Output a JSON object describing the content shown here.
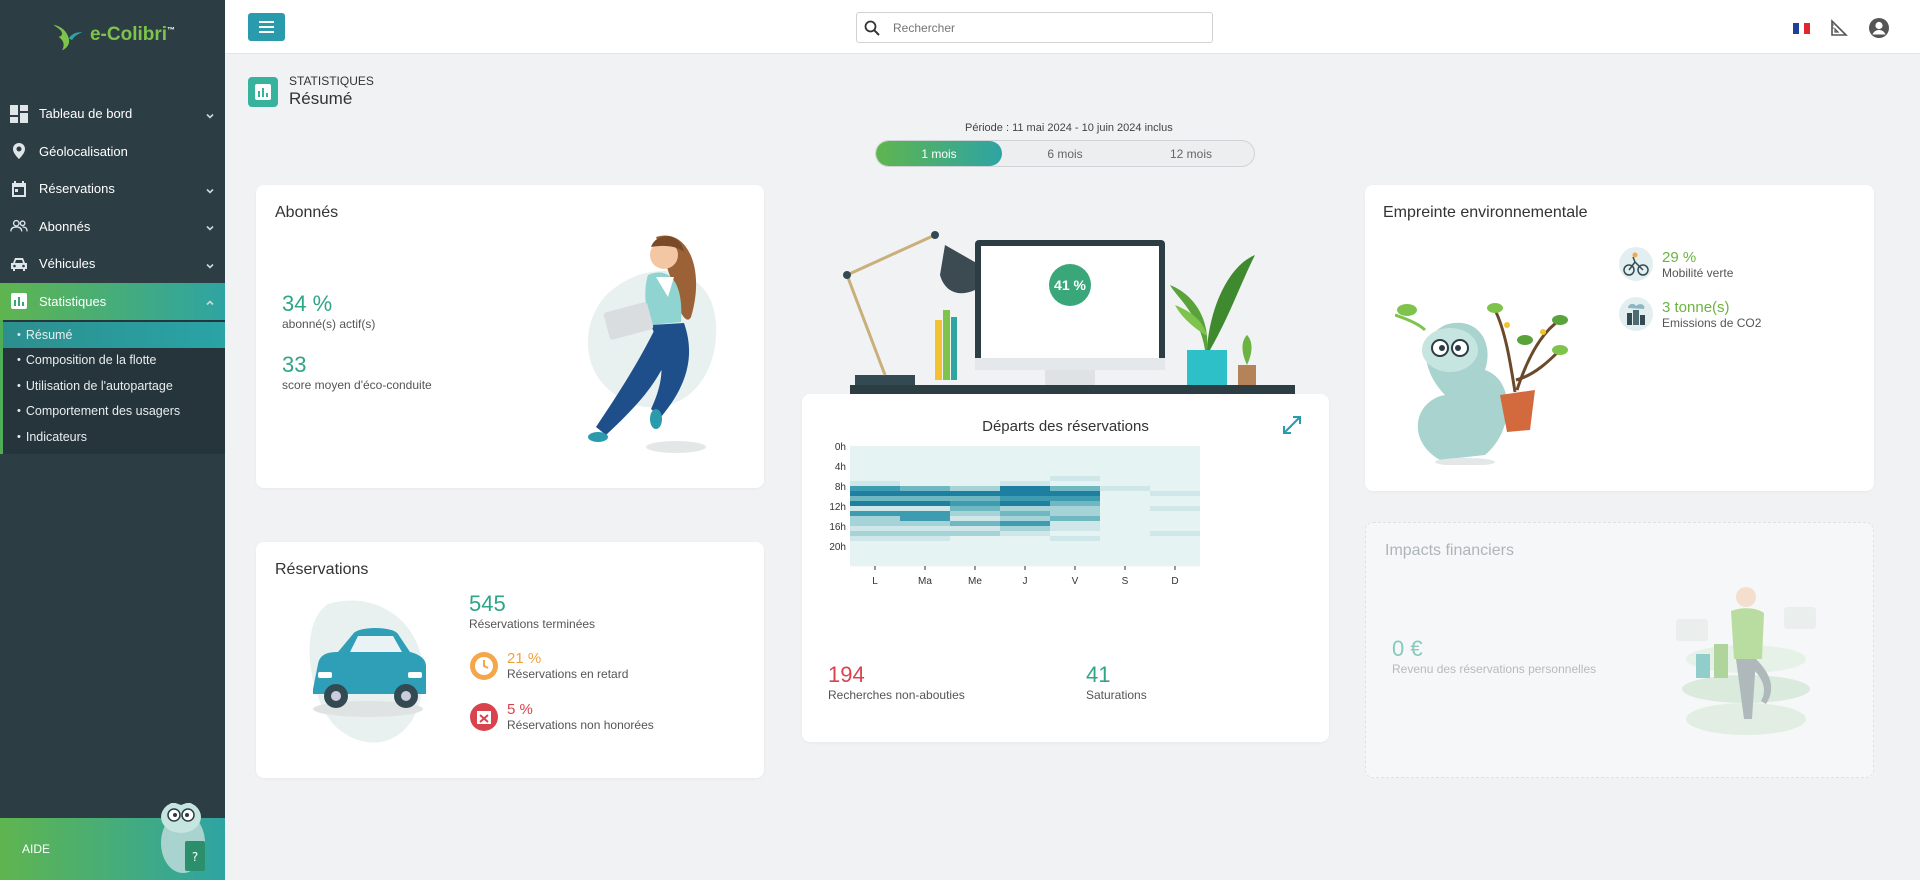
{
  "app": {
    "logo": "e-Colibri",
    "logo_mark": "™"
  },
  "sidebar": {
    "items": [
      {
        "label": "Tableau de bord",
        "icon": "dashboard-icon",
        "has_chevron": true
      },
      {
        "label": "Géolocalisation",
        "icon": "map-pin-icon",
        "has_chevron": false
      },
      {
        "label": "Réservations",
        "icon": "calendar-icon",
        "has_chevron": true
      },
      {
        "label": "Abonnés",
        "icon": "users-icon",
        "has_chevron": true
      },
      {
        "label": "Véhicules",
        "icon": "car-icon",
        "has_chevron": true
      },
      {
        "label": "Statistiques",
        "icon": "bar-chart-icon",
        "has_chevron": true,
        "active": true
      }
    ],
    "subitems": [
      {
        "label": "Résumé",
        "active": true
      },
      {
        "label": "Composition de la flotte"
      },
      {
        "label": "Utilisation de l'autopartage"
      },
      {
        "label": "Comportement des usagers"
      },
      {
        "label": "Indicateurs"
      }
    ],
    "help_label": "AIDE"
  },
  "topbar": {
    "search_placeholder": "Rechercher",
    "icons": [
      "flag-fr-icon",
      "ruler-triangle-icon",
      "user-circle-icon"
    ]
  },
  "page": {
    "pretitle": "STATISTIQUES",
    "title": "Résumé"
  },
  "period": {
    "label": "Période : 11 mai 2024 - 10 juin 2024 inclus",
    "options": [
      "1 mois",
      "6 mois",
      "12 mois"
    ],
    "selected": "1 mois"
  },
  "abonnes": {
    "title": "Abonnés",
    "active_value": "34 %",
    "active_label": "abonné(s) actif(s)",
    "score_value": "33",
    "score_label": "score moyen d'éco-conduite"
  },
  "reservations": {
    "title": "Réservations",
    "done_value": "545",
    "done_label": "Réservations terminées",
    "late_value": "21 %",
    "late_label": "Réservations en retard",
    "noshow_value": "5 %",
    "noshow_label": "Réservations non honorées"
  },
  "desk": {
    "screen_value": "41 %"
  },
  "departs": {
    "title": "Départs des réservations",
    "failed_value": "194",
    "failed_label": "Recherches non-abouties",
    "saturation_value": "41",
    "saturation_label": "Saturations"
  },
  "chart_data": {
    "type": "heatmap",
    "title": "Départs des réservations",
    "x": [
      "L",
      "Ma",
      "Me",
      "J",
      "V",
      "S",
      "D"
    ],
    "y_ticks": [
      "0h",
      "4h",
      "8h",
      "12h",
      "16h",
      "20h"
    ],
    "rows_per_day": 24,
    "colors": [
      "#e6f3f3",
      "#cfe7e8",
      "#a6d3d7",
      "#6fb8c2",
      "#3d9cb0",
      "#1f7fa0"
    ],
    "intensity": [
      [
        0,
        0,
        0,
        0,
        0,
        0,
        0,
        1,
        4,
        5,
        3,
        5,
        1,
        4,
        2,
        2,
        1,
        2,
        1,
        0,
        0,
        0,
        0,
        0
      ],
      [
        0,
        0,
        0,
        0,
        0,
        0,
        0,
        0,
        3,
        5,
        3,
        5,
        1,
        4,
        4,
        2,
        1,
        2,
        1,
        0,
        0,
        0,
        0,
        0
      ],
      [
        0,
        0,
        0,
        0,
        0,
        0,
        0,
        0,
        2,
        5,
        3,
        4,
        3,
        2,
        1,
        3,
        1,
        2,
        0,
        0,
        0,
        0,
        0,
        0
      ],
      [
        0,
        0,
        0,
        0,
        0,
        0,
        0,
        1,
        5,
        5,
        4,
        5,
        2,
        3,
        2,
        4,
        2,
        1,
        0,
        0,
        0,
        0,
        0,
        0
      ],
      [
        0,
        0,
        0,
        0,
        0,
        0,
        1,
        0,
        3,
        5,
        4,
        3,
        2,
        2,
        3,
        1,
        1,
        0,
        1,
        0,
        0,
        0,
        0,
        0
      ],
      [
        0,
        0,
        0,
        0,
        0,
        0,
        0,
        0,
        1,
        0,
        0,
        0,
        0,
        0,
        0,
        0,
        0,
        0,
        0,
        0,
        0,
        0,
        0,
        0
      ],
      [
        0,
        0,
        0,
        0,
        0,
        0,
        0,
        0,
        0,
        1,
        0,
        0,
        1,
        0,
        0,
        0,
        0,
        1,
        0,
        0,
        0,
        0,
        0,
        0
      ]
    ]
  },
  "empreinte": {
    "title": "Empreinte environnementale",
    "green_value": "29 %",
    "green_label": "Mobilité verte",
    "co2_value": "3 tonne(s)",
    "co2_label": "Emissions de CO2"
  },
  "impacts": {
    "title": "Impacts financiers",
    "value": "0 €",
    "label": "Revenu des réservations personnelles"
  }
}
